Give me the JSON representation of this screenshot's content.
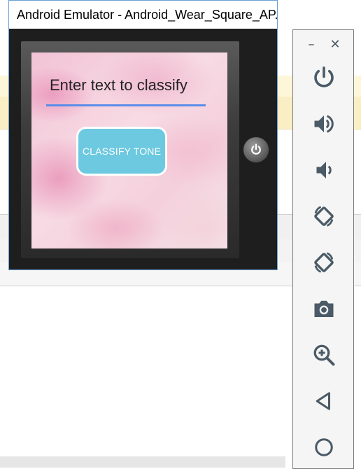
{
  "emulator": {
    "title": "Android Emulator - Android_Wear_Square_AP..."
  },
  "app": {
    "input_placeholder": "Enter text to classify",
    "button_label": "CLASSIFY TONE"
  },
  "side_panel": {
    "minimize_glyph": "–",
    "close_glyph": "✕",
    "controls": [
      {
        "icon": "power-icon"
      },
      {
        "icon": "volume-up-icon"
      },
      {
        "icon": "volume-down-icon"
      },
      {
        "icon": "rotate-left-icon"
      },
      {
        "icon": "rotate-right-icon"
      },
      {
        "icon": "camera-icon"
      },
      {
        "icon": "zoom-in-icon"
      },
      {
        "icon": "back-icon"
      },
      {
        "icon": "home-icon"
      }
    ]
  },
  "colors": {
    "icon": "#4a5a66",
    "button": "#6cc9e0",
    "underline": "#5b8de8"
  }
}
